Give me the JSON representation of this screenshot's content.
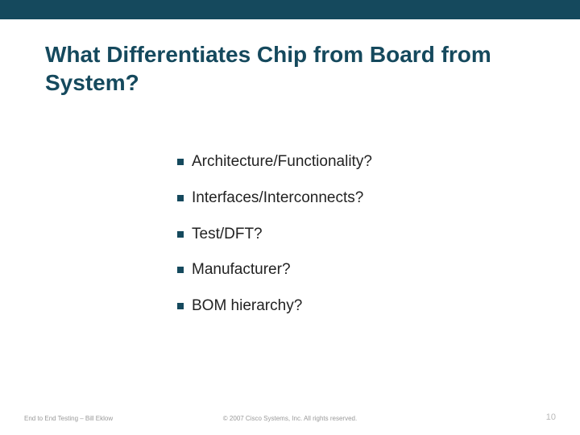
{
  "slide": {
    "title": "What Differentiates Chip from Board from System?",
    "bullets": [
      "Architecture/Functionality?",
      "Interfaces/Interconnects?",
      "Test/DFT?",
      "Manufacturer?",
      "BOM hierarchy?"
    ],
    "footer": {
      "left": "End to End Testing – Bill Eklow",
      "center": "© 2007 Cisco Systems, Inc. All rights reserved.",
      "page_number": "10"
    },
    "accent_color": "#15495d"
  }
}
